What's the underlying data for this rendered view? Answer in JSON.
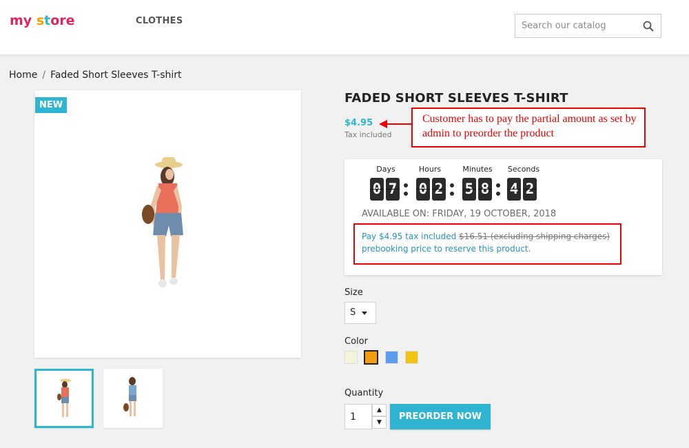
{
  "header": {
    "logo_parts": [
      "my",
      " ",
      "s",
      "t",
      "ore"
    ],
    "nav_item": "CLOTHES",
    "search_placeholder": "Search our catalog"
  },
  "breadcrumb": {
    "home": "Home",
    "separator": "/",
    "current": "Faded Short Sleeves T-shirt"
  },
  "product": {
    "badge": "NEW",
    "title": "FADED SHORT SLEEVES T-SHIRT",
    "price": "$4.95",
    "tax_note": "Tax included"
  },
  "annotation": {
    "text": "Customer has to pay the partial amount as set by admin to preorder the product"
  },
  "countdown": {
    "labels": [
      "Days",
      "Hours",
      "Minutes",
      "Seconds"
    ],
    "digits": [
      "0",
      "7",
      "0",
      "2",
      "5",
      "8",
      "4",
      "2"
    ]
  },
  "preorder": {
    "available_on": "AVAILABLE ON: FRIDAY, 19 OCTOBER, 2018",
    "pay_prefix": "Pay $4.95 tax included ",
    "original_price": "$16.51 (excluding shipping charges)",
    "pay_suffix": "prebooking price to reserve this product."
  },
  "options": {
    "size_label": "Size",
    "size_value": "S",
    "color_label": "Color",
    "colors": [
      "#f5f3dc",
      "#f39c11",
      "#5d9cec",
      "#f1c40f"
    ],
    "selected_color_index": 1
  },
  "purchase": {
    "quantity_label": "Quantity",
    "quantity_value": "1",
    "button_label": "PREORDER NOW"
  },
  "colors": {
    "accent": "#2fb5d2",
    "annotation_red": "#ee0000"
  }
}
